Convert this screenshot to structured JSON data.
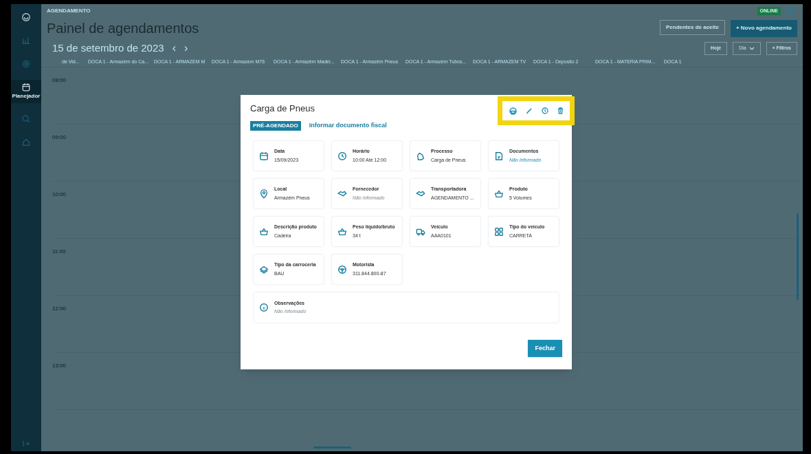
{
  "sidebar": {
    "items": [
      {
        "selected": false
      },
      {
        "selected": false
      },
      {
        "selected": false
      },
      {
        "label": "Planejador",
        "selected": true
      },
      {
        "selected": false
      },
      {
        "selected": false
      }
    ]
  },
  "header": {
    "breadcrumb": "AGENDAMENTO",
    "status_badge": "ONLINE"
  },
  "page": {
    "title": "Painel de agendamentos",
    "date": "15 de setembro de 2023",
    "prev": "‹",
    "next": "›"
  },
  "actions": {
    "pending_button": "Pendentes de aceite",
    "new_button": "+ Novo agendamento",
    "today_button": "Hoje",
    "view_select": "Dia",
    "filters_button": "« Filtros"
  },
  "columns": [
    "de Vid...",
    "DOCA 1 - Armazém do Ca...",
    "DOCA 1 - ARMAZEM M",
    "DOCA 1 - Armazem M76",
    "DOCA 1 - Armazém Madei...",
    "DOCA 1 - Armazém Pneus",
    "DOCA 1 - Armazém Tubos...",
    "DOCA 1 - ARMAZEM TV",
    "DOCA 1 - Deposito 2",
    "DOCA 1 - MATERIA PRIM...",
    "DOCA 1"
  ],
  "hours": [
    "08:00",
    "09:00",
    "10:00",
    "11:00",
    "12:00",
    "13:00"
  ],
  "modal": {
    "title": "Carga de Pneus",
    "status_badge": "PRÉ-AGENDADO",
    "fiscal_link": "Informar documento fiscal",
    "fields": [
      {
        "label": "Data",
        "value": "15/09/2023",
        "kind": "text"
      },
      {
        "label": "Horário",
        "value": "10:00 Até 12:00",
        "kind": "text"
      },
      {
        "label": "Processo",
        "value": "Carga de Pneus",
        "kind": "text"
      },
      {
        "label": "Documentos",
        "value": "Não Informado",
        "kind": "link"
      },
      {
        "label": "Local",
        "value": "Armazém Pneus",
        "kind": "text"
      },
      {
        "label": "Fornecedor",
        "value": "Não Informado",
        "kind": "missing"
      },
      {
        "label": "Transportadora",
        "value": "AGENDAMENTO ...",
        "kind": "text"
      },
      {
        "label": "Produto",
        "value": "5 Volumes",
        "kind": "text"
      },
      {
        "label": "Descrição produto",
        "value": "Cadeira",
        "kind": "text"
      },
      {
        "label": "Peso líquido/bruto",
        "value": "34 t",
        "kind": "text"
      },
      {
        "label": "Veículo",
        "value": "AAA0101",
        "kind": "text"
      },
      {
        "label": "Tipo do veículo",
        "value": "CARRETA",
        "kind": "text"
      },
      {
        "label": "Tipo da carroceria",
        "value": "BAU",
        "kind": "text"
      },
      {
        "label": "Motorista",
        "value": "311.844.800-87",
        "kind": "text"
      }
    ],
    "notes": {
      "label": "Observações",
      "value": "Não Informado",
      "kind": "missing"
    },
    "close_button": "Fechar"
  }
}
